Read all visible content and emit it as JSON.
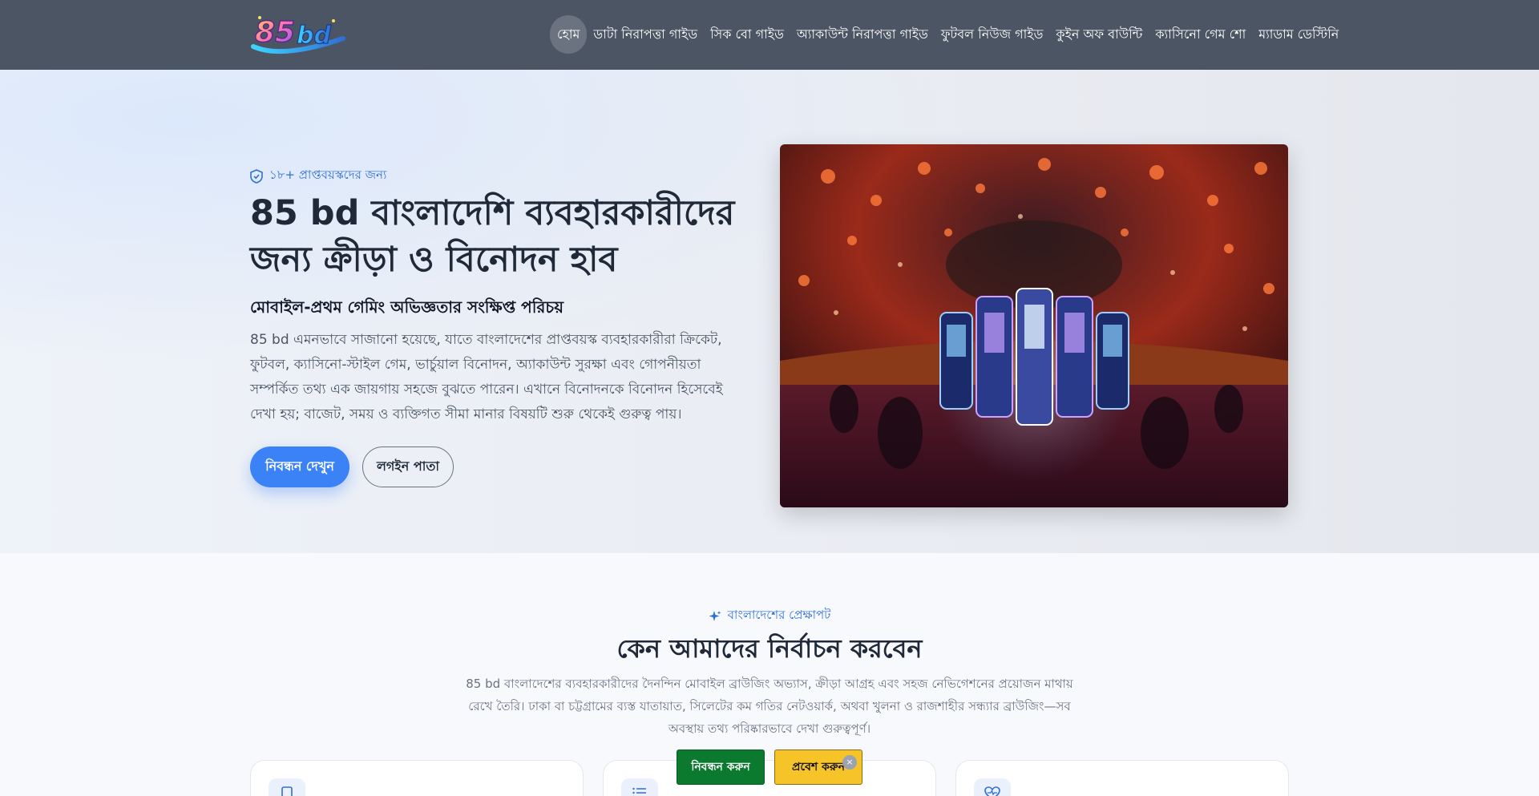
{
  "header": {
    "logo_text": "85bd",
    "nav": [
      {
        "label": "হোম"
      },
      {
        "label": "ডাটা নিরাপত্তা গাইড"
      },
      {
        "label": "সিক বো গাইড"
      },
      {
        "label": "অ্যাকাউন্ট নিরাপত্তা গাইড"
      },
      {
        "label": "ফুটবল নিউজ গাইড"
      },
      {
        "label": "কুইন অফ বাউন্টি"
      },
      {
        "label": "ক্যাসিনো গেম শো"
      },
      {
        "label": "ম্যাডাম ডেস্টিনি"
      }
    ]
  },
  "hero": {
    "eyebrow": "১৮+ প্রাপ্তবয়স্কদের জন্য",
    "title": "85 bd বাংলাদেশি ব্যবহারকারীদের জন্য ক্রীড়া ও বিনোদন হাব",
    "subtitle": "মোবাইল-প্রথম গেমিং অভিজ্ঞতার সংক্ষিপ্ত পরিচয়",
    "description": "85 bd এমনভাবে সাজানো হয়েছে, যাতে বাংলাদেশের প্রাপ্তবয়স্ক ব্যবহারকারীরা ক্রিকেট, ফুটবল, ক্যাসিনো-স্টাইল গেম, ভার্চুয়াল বিনোদন, অ্যাকাউন্ট সুরক্ষা এবং গোপনীয়তা সম্পর্কিত তথ্য এক জায়গায় সহজে বুঝতে পারেন। এখানে বিনোদনকে বিনোদন হিসেবেই দেখা হয়; বাজেট, সময় ও ব্যক্তিগত সীমা মানার বিষয়টি শুরু থেকেই গুরুত্ব পায়।",
    "primary_button": "নিবন্ধন দেখুন",
    "secondary_button": "লগইন পাতা"
  },
  "section": {
    "eyebrow": "বাংলাদেশের প্রেক্ষাপট",
    "title": "কেন আমাদের নির্বাচন করবেন",
    "description": "85 bd বাংলাদেশের ব্যবহারকারীদের দৈনন্দিন মোবাইল ব্রাউজিং অভ্যাস, ক্রীড়া আগ্রহ এবং সহজ নেভিগেশনের প্রয়োজন মাথায় রেখে তৈরি। ঢাকা বা চট্টগ্রামের ব্যস্ত যাতায়াত, সিলেটের কম গতির নেটওয়ার্ক, অথবা খুলনা ও রাজশাহীর সন্ধ্যার ব্রাউজিং—সব অবস্থায় তথ্য পরিষ্কারভাবে দেখা গুরুত্বপূর্ণ।"
  },
  "sticky": {
    "register": "নিবন্ধন করুন",
    "enter": "প্রবেশ করুন",
    "close": "×"
  },
  "colors": {
    "header_bg": "#4b5563",
    "accent": "#3b82f6",
    "register_green": "#0b7a2e",
    "enter_yellow": "#f6c428"
  }
}
